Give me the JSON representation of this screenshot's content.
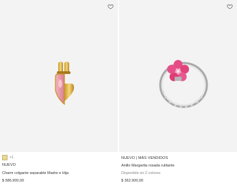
{
  "products": [
    {
      "tag": "NUEVO",
      "name": "Charm colgante separable Madre e Hija",
      "price": "$ 586.900,00",
      "swatch_more": "+1",
      "colors": {
        "gold": "#e6b94a",
        "pink": "#e79aa6"
      }
    },
    {
      "tag": "NUEVO | MÁS VENDIDOS",
      "name": "Anillo Margarita rosada rutilante",
      "availability": "Disponible en 2 colores",
      "price": "$ 362.900,00",
      "colors": {
        "silver": "#b9b9b9",
        "pink": "#e2477f"
      }
    }
  ],
  "icons": {
    "wishlist": "heart-outline-icon"
  }
}
